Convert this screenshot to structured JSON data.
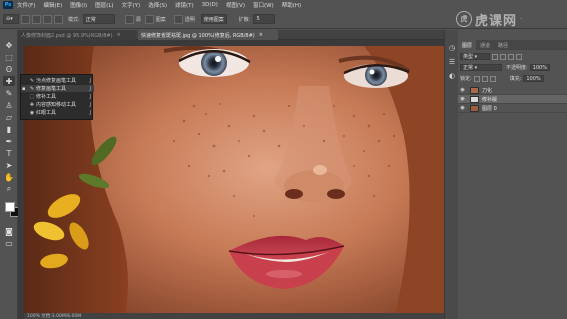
{
  "app": {
    "logo_text": "Ps"
  },
  "menubar": {
    "items": [
      "文件(F)",
      "编辑(E)",
      "图像(I)",
      "图层(L)",
      "文字(Y)",
      "选择(S)",
      "滤镜(T)",
      "3D(D)",
      "视图(V)",
      "窗口(W)",
      "帮助(H)"
    ]
  },
  "options": {
    "tool_mode_label": "模式:",
    "mode_value": "正常",
    "source_label": "源",
    "pattern_label": "图案",
    "transparent_label": "透明",
    "use_pattern_label": "使用图案",
    "diffusion_label": "扩散:",
    "diffusion_value": "5"
  },
  "watermark": {
    "logo": "虎",
    "text": "虎课网",
    "dot": "·"
  },
  "tabs": {
    "doc1": "人像修饰封面2.psd @ 95.9%(RGB/8#)",
    "doc2": "快速修复雀斑祛斑.jpg @ 100%(修复后, RGB/8#)",
    "close": "×"
  },
  "flyout": {
    "items": [
      {
        "icon": "✎",
        "label": "污点修复画笔工具",
        "key": "J",
        "selected": false
      },
      {
        "icon": "✎",
        "label": "修复画笔工具",
        "key": "J",
        "selected": true
      },
      {
        "icon": "⬚",
        "label": "修补工具",
        "key": "J",
        "selected": false
      },
      {
        "icon": "✥",
        "label": "内容感知移动工具",
        "key": "J",
        "selected": false
      },
      {
        "icon": "◉",
        "label": "红眼工具",
        "key": "J",
        "selected": false
      }
    ]
  },
  "layers_panel": {
    "tabs": [
      "图层",
      "通道",
      "路径"
    ],
    "kind_filter": "类型",
    "blend_mode": "正常",
    "opacity_label": "不透明度:",
    "opacity_value": "100%",
    "lock_label": "锁定:",
    "fill_label": "填充:",
    "fill_value": "100%",
    "layers": [
      {
        "name": "刀化",
        "selected": false,
        "thumb_color": "#a86a4a"
      },
      {
        "name": "修补版",
        "selected": true,
        "thumb_color": "#d9d9d9"
      },
      {
        "name": "图层 0",
        "selected": false,
        "thumb_color": "#9a5d3e"
      }
    ]
  },
  "status": {
    "text": "100%    文档:3.00M/6.00M"
  },
  "colors": {
    "foreground": "#ffffff",
    "background": "#111111",
    "accent": "#31a8ff"
  }
}
